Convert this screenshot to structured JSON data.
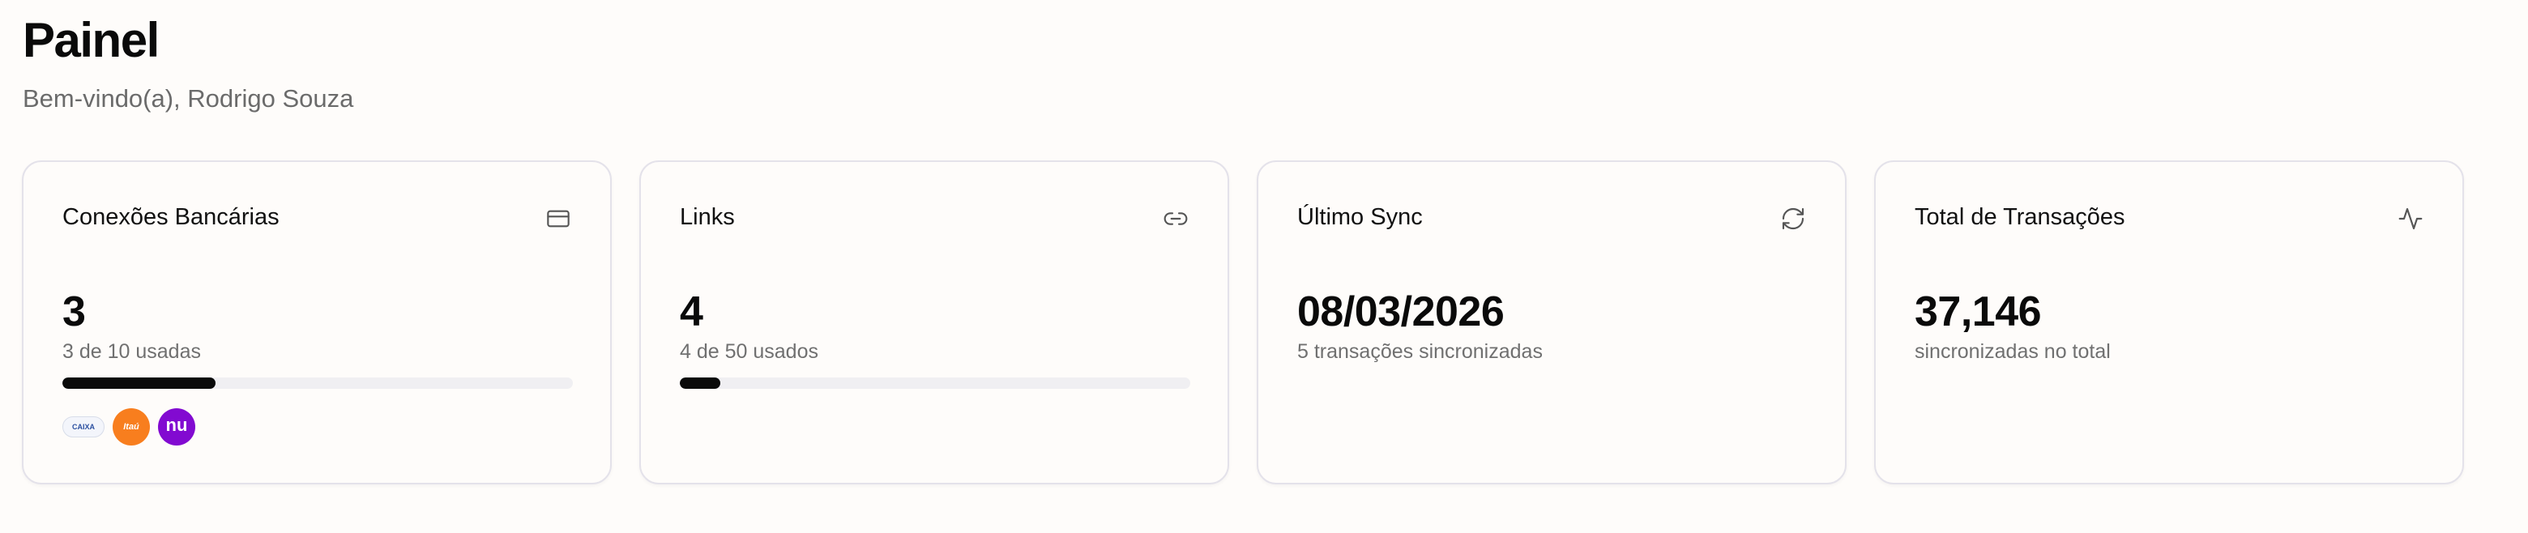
{
  "header": {
    "title": "Painel",
    "subtitle": "Bem-vindo(a), Rodrigo Souza"
  },
  "cards": [
    {
      "title": "Conexões Bancárias",
      "icon": "credit-card-icon",
      "value": "3",
      "subtitle": "3 de 10 usadas",
      "progress": 0.3,
      "banks": [
        {
          "name": "caixa-logo",
          "text": "CAIXA",
          "color": "#2a4fa0"
        },
        {
          "name": "itau-logo",
          "text": "Itaú",
          "color": "#f87e1e"
        },
        {
          "name": "nubank-logo",
          "text": "nu",
          "color": "#820ad1"
        }
      ]
    },
    {
      "title": "Links",
      "icon": "link-icon",
      "value": "4",
      "subtitle": "4 de 50 usados",
      "progress": 0.08
    },
    {
      "title": "Último Sync",
      "icon": "refresh-icon",
      "value": "08/03/2026",
      "subtitle": "5 transações sincronizadas"
    },
    {
      "title": "Total de Transações",
      "icon": "activity-icon",
      "value": "37,146",
      "subtitle": "sincronizadas no total"
    }
  ],
  "colors": {
    "background": "#fefcfa",
    "card_border": "#e4e2ea",
    "progress_fill": "#0a0a0a",
    "progress_track": "#f0eff2"
  }
}
